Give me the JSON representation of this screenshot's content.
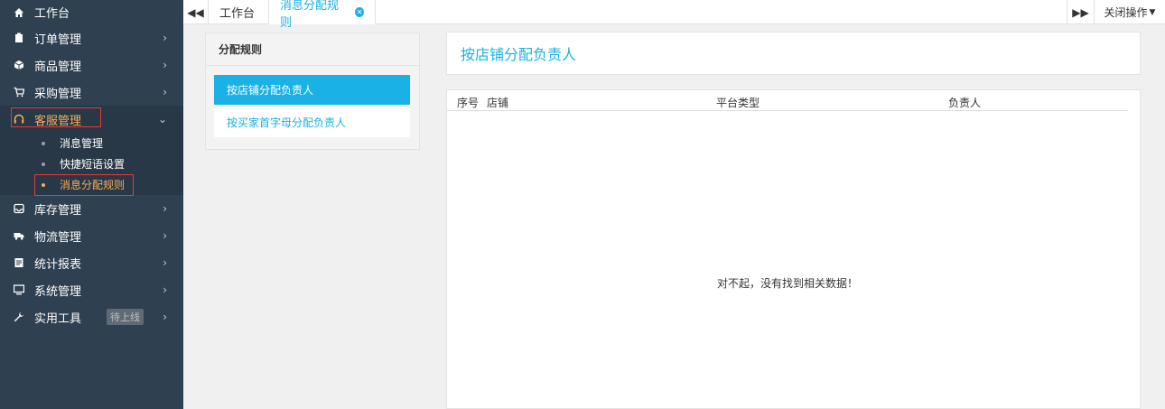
{
  "sidebar": {
    "workbench": {
      "label": "工作台",
      "icon": "home-icon"
    },
    "items": [
      {
        "key": "orders",
        "label": "订单管理",
        "icon": "clipboard-icon"
      },
      {
        "key": "products",
        "label": "商品管理",
        "icon": "cube-icon"
      },
      {
        "key": "purchase",
        "label": "采购管理",
        "icon": "cart-icon"
      },
      {
        "key": "service",
        "label": "客服管理",
        "icon": "headset-icon",
        "expanded": true
      },
      {
        "key": "inventory",
        "label": "库存管理",
        "icon": "inbox-icon"
      },
      {
        "key": "logistics",
        "label": "物流管理",
        "icon": "truck-icon"
      },
      {
        "key": "reports",
        "label": "统计报表",
        "icon": "report-icon"
      },
      {
        "key": "system",
        "label": "系统管理",
        "icon": "monitor-icon"
      },
      {
        "key": "tools",
        "label": "实用工具",
        "icon": "wrench-icon",
        "badge": "待上线"
      }
    ],
    "service_sub": [
      {
        "label": "消息管理"
      },
      {
        "label": "快捷短语设置"
      },
      {
        "label": "消息分配规则",
        "active": true
      }
    ]
  },
  "tabs": {
    "workbench": "工作台",
    "active": "消息分配规则",
    "close_ops": "关闭操作"
  },
  "rules": {
    "title": "分配规则",
    "items": [
      {
        "label": "按店铺分配负责人",
        "active": true
      },
      {
        "label": "按买家首字母分配负责人",
        "active": false
      }
    ]
  },
  "content": {
    "title": "按店铺分配负责人",
    "columns": [
      "序号",
      "店铺",
      "平台类型",
      "负责人"
    ],
    "empty": "对不起，没有找到相关数据！"
  },
  "colors": {
    "sidebar_bg": "#2f4050",
    "accent": "#1ab1e6",
    "active_orange": "#f8ac59",
    "highlight_red": "#e23b3b"
  }
}
